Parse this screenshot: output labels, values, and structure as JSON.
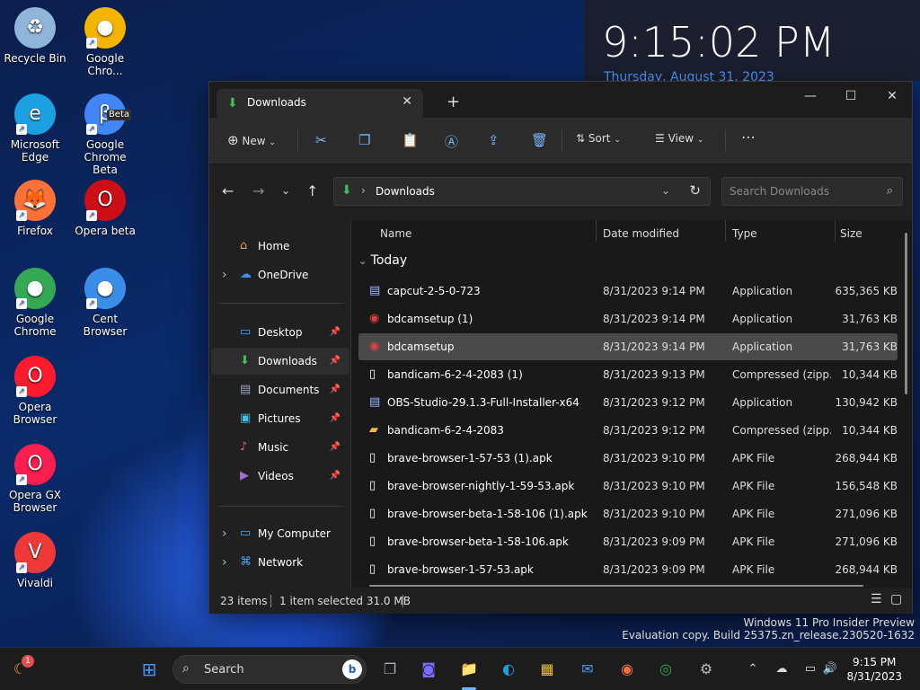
{
  "desktop": {
    "icons": [
      {
        "label": "Recycle Bin",
        "color": "#8fb6d8",
        "glyph": "♻"
      },
      {
        "label": "Google Chro...",
        "color": "#f4b400",
        "glyph": "●"
      },
      {
        "label": "Microsoft Edge",
        "color": "#1ba1e2",
        "glyph": "e"
      },
      {
        "label": "Google Chrome Beta",
        "color": "#4285f4",
        "glyph": "β"
      },
      {
        "label": "Firefox",
        "color": "#ff7139",
        "glyph": "🦊"
      },
      {
        "label": "Opera beta",
        "color": "#cc0f16",
        "glyph": "O"
      },
      {
        "label": "Google Chrome",
        "color": "#34a853",
        "glyph": "●"
      },
      {
        "label": "Cent Browser",
        "color": "#3b8ee8",
        "glyph": "●"
      },
      {
        "label": "Opera Browser",
        "color": "#ff1b2d",
        "glyph": "O"
      },
      {
        "label": "Opera GX Browser",
        "color": "#fa1e4e",
        "glyph": "O"
      },
      {
        "label": "Vivaldi",
        "color": "#ef3939",
        "glyph": "V"
      }
    ],
    "beta_badge": "Beta"
  },
  "clock": {
    "time": "9:15:02 PM",
    "date": "Thursday, August 31, 2023"
  },
  "window": {
    "tab_label": "Downloads",
    "toolbar": {
      "new_label": "New",
      "sort_label": "Sort",
      "view_label": "View"
    },
    "address": {
      "path": "Downloads"
    },
    "search": {
      "placeholder": "Search Downloads"
    },
    "nav": [
      {
        "label": "Home",
        "icon": "⌂",
        "color": "#e8a060"
      },
      {
        "label": "OneDrive",
        "icon": "☁",
        "color": "#3c8ef0"
      },
      {
        "label": "Desktop",
        "icon": "▭",
        "color": "#4aa3ff"
      },
      {
        "label": "Downloads",
        "icon": "⬇",
        "color": "#3fc05a"
      },
      {
        "label": "Documents",
        "icon": "▤",
        "color": "#9aa8c0"
      },
      {
        "label": "Pictures",
        "icon": "▣",
        "color": "#3dc1e0"
      },
      {
        "label": "Music",
        "icon": "♪",
        "color": "#e06a6a"
      },
      {
        "label": "Videos",
        "icon": "▶",
        "color": "#9f6ae0"
      },
      {
        "label": "My Computer",
        "icon": "▭",
        "color": "#4aa3ff"
      },
      {
        "label": "Network",
        "icon": "⌘",
        "color": "#4aa3ff"
      }
    ],
    "columns": {
      "name": "Name",
      "date": "Date modified",
      "type": "Type",
      "size": "Size"
    },
    "group": "Today",
    "files": [
      {
        "name": "capcut-2-5-0-723",
        "date": "8/31/2023 9:14 PM",
        "type": "Application",
        "size": "635,365 KB",
        "icon": "▤",
        "color": "#9bb7ff"
      },
      {
        "name": "bdcamsetup (1)",
        "date": "8/31/2023 9:14 PM",
        "type": "Application",
        "size": "31,763 KB",
        "icon": "◉",
        "color": "#e04040"
      },
      {
        "name": "bdcamsetup",
        "date": "8/31/2023 9:14 PM",
        "type": "Application",
        "size": "31,763 KB",
        "icon": "◉",
        "color": "#e04040"
      },
      {
        "name": "bandicam-6-2-4-2083 (1)",
        "date": "8/31/2023 9:13 PM",
        "type": "Compressed (zipp...",
        "size": "10,344 KB",
        "icon": "▯",
        "color": "#ffffff"
      },
      {
        "name": "OBS-Studio-29.1.3-Full-Installer-x64",
        "date": "8/31/2023 9:12 PM",
        "type": "Application",
        "size": "130,942 KB",
        "icon": "▤",
        "color": "#9bb7ff"
      },
      {
        "name": "bandicam-6-2-4-2083",
        "date": "8/31/2023 9:12 PM",
        "type": "Compressed (zipp...",
        "size": "10,344 KB",
        "icon": "▰",
        "color": "#e8b84a"
      },
      {
        "name": "brave-browser-1-57-53 (1).apk",
        "date": "8/31/2023 9:10 PM",
        "type": "APK File",
        "size": "268,944 KB",
        "icon": "▯",
        "color": "#ffffff"
      },
      {
        "name": "brave-browser-nightly-1-59-53.apk",
        "date": "8/31/2023 9:10 PM",
        "type": "APK File",
        "size": "156,548 KB",
        "icon": "▯",
        "color": "#ffffff"
      },
      {
        "name": "brave-browser-beta-1-58-106 (1).apk",
        "date": "8/31/2023 9:10 PM",
        "type": "APK File",
        "size": "271,096 KB",
        "icon": "▯",
        "color": "#ffffff"
      },
      {
        "name": "brave-browser-beta-1-58-106.apk",
        "date": "8/31/2023 9:09 PM",
        "type": "APK File",
        "size": "271,096 KB",
        "icon": "▯",
        "color": "#ffffff"
      },
      {
        "name": "brave-browser-1-57-53.apk",
        "date": "8/31/2023 9:09 PM",
        "type": "APK File",
        "size": "268,944 KB",
        "icon": "▯",
        "color": "#ffffff"
      }
    ],
    "status": {
      "items": "23 items",
      "selected": "1 item selected  31.0 MB"
    }
  },
  "watermark": {
    "line1": "Windows 11 Pro Insider Preview",
    "line2": "Evaluation copy. Build 25375.zn_release.230520-1632"
  },
  "taskbar": {
    "search_label": "Search",
    "notification_count": "1",
    "time": "9:15 PM",
    "date": "8/31/2023"
  }
}
